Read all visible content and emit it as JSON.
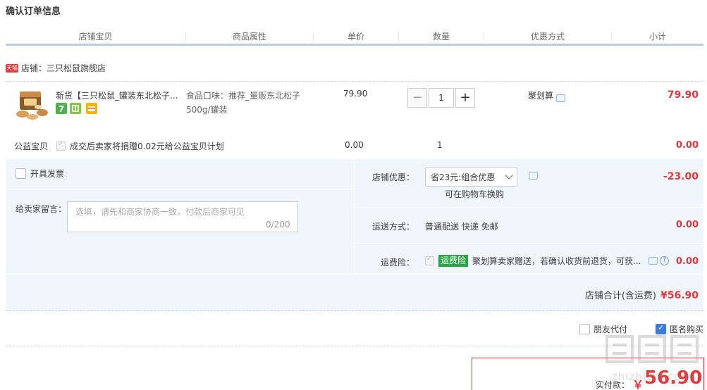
{
  "page": {
    "section_title": "确认订单信息"
  },
  "columns": {
    "shop_item": "店铺宝贝",
    "attributes": "商品属性",
    "unit_price": "单价",
    "quantity": "数量",
    "discount_method": "优惠方式",
    "subtotal": "小计"
  },
  "shop": {
    "badge": "天猫",
    "label": "店铺：三只松鼠旗舰店"
  },
  "item": {
    "name": "新货【三只松鼠_罐装东北松子...",
    "attributes": "食品口味：推荐_量贩东北松子500g/罐装",
    "price": "79.90",
    "quantity": "1",
    "minus_label": "−",
    "plus_label": "+",
    "deal": "聚划算",
    "subtotal": "79.90",
    "service_icons": [
      "seven-day-return-icon",
      "delivery-guarantee-icon",
      "credit-card-icon"
    ]
  },
  "charity": {
    "label": "公益宝贝",
    "text": "成交后卖家将捐赠0.02元给公益宝贝计划",
    "price": "0.00",
    "quantity": "1",
    "subtotal": "0.00"
  },
  "invoice": {
    "label": "开具发票"
  },
  "message": {
    "label": "给卖家留言：",
    "placeholder": "选填，请先和商家协商一致，付款后商家可见",
    "counter": "0/200"
  },
  "shop_discount": {
    "label": "店铺优惠：",
    "selected": "省23元:组合优惠",
    "cart_swap": "可在购物车换购",
    "value": "-23.00"
  },
  "shipping": {
    "label": "运送方式：",
    "text": "普通配送 快递 免邮",
    "value": "0.00"
  },
  "insurance": {
    "label": "运费险：",
    "badge": "运费险",
    "text": "聚划算卖家赠送，若确认收货前退货，可获...",
    "value": "0.00"
  },
  "shop_total": {
    "label": "店铺合计(含运费)",
    "value": "¥56.90"
  },
  "options": {
    "friend_pay": "朋友代付",
    "anonymous": "匿名购买",
    "anonymous_checked": true
  },
  "payment": {
    "label": "实付款：",
    "currency": "￥",
    "amount": "56.90"
  },
  "watermark": {
    "brand": "值值值",
    "domain": "zhizhizhi.com"
  },
  "colors": {
    "price_red": "#e4393c",
    "panel_blue": "#f0f6fc",
    "header_line": "#b9cde6",
    "check_blue": "#3d7bd9",
    "insurance_green": "#28a745"
  }
}
